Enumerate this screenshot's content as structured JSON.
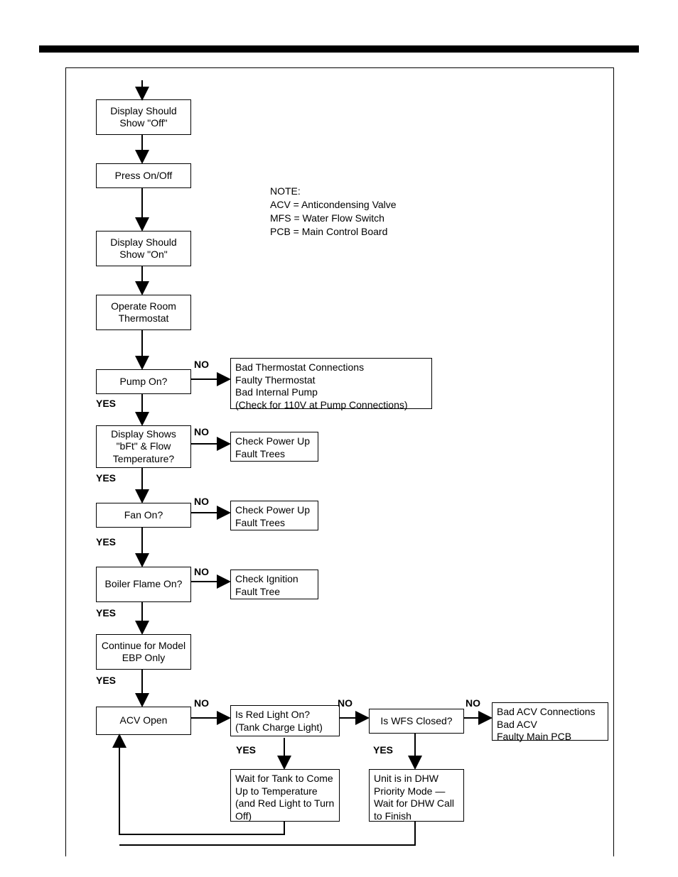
{
  "note": {
    "heading": "NOTE:",
    "l1": "ACV = Anticondensing Valve",
    "l2": "MFS = Water Flow Switch",
    "l3": "PCB = Main Control Board"
  },
  "boxes": {
    "b1": "Display Should Show \"Off\"",
    "b2": "Press On/Off",
    "b3": "Display Should Show \"On\"",
    "b4": "Operate Room Thermostat",
    "b5": "Pump On?",
    "b5no": "Bad Thermostat Connections\nFaulty Thermostat\nBad Internal Pump\n(Check for 110V at Pump Connections)",
    "b6": "Display Shows \"bFt\" & Flow Temperature?",
    "b6no": "Check Power Up Fault Trees",
    "b7": "Fan On?",
    "b7no": "Check Power Up Fault Trees",
    "b8": "Boiler Flame On?",
    "b8no": "Check Ignition Fault Tree",
    "b9": "Continue for Model EBP Only",
    "b10": "ACV Open",
    "b11": "Is Red Light On? (Tank Charge Light)",
    "b11yes": "Wait for Tank to Come Up to Temperature (and Red Light to Turn Off)",
    "b12": "Is WFS Closed?",
    "b12yes": "Unit is in DHW Priority Mode — Wait for DHW Call to Finish",
    "b12no": "Bad ACV Connections\nBad ACV\nFaulty Main PCB"
  },
  "labels": {
    "yes": "YES",
    "no": "NO"
  }
}
